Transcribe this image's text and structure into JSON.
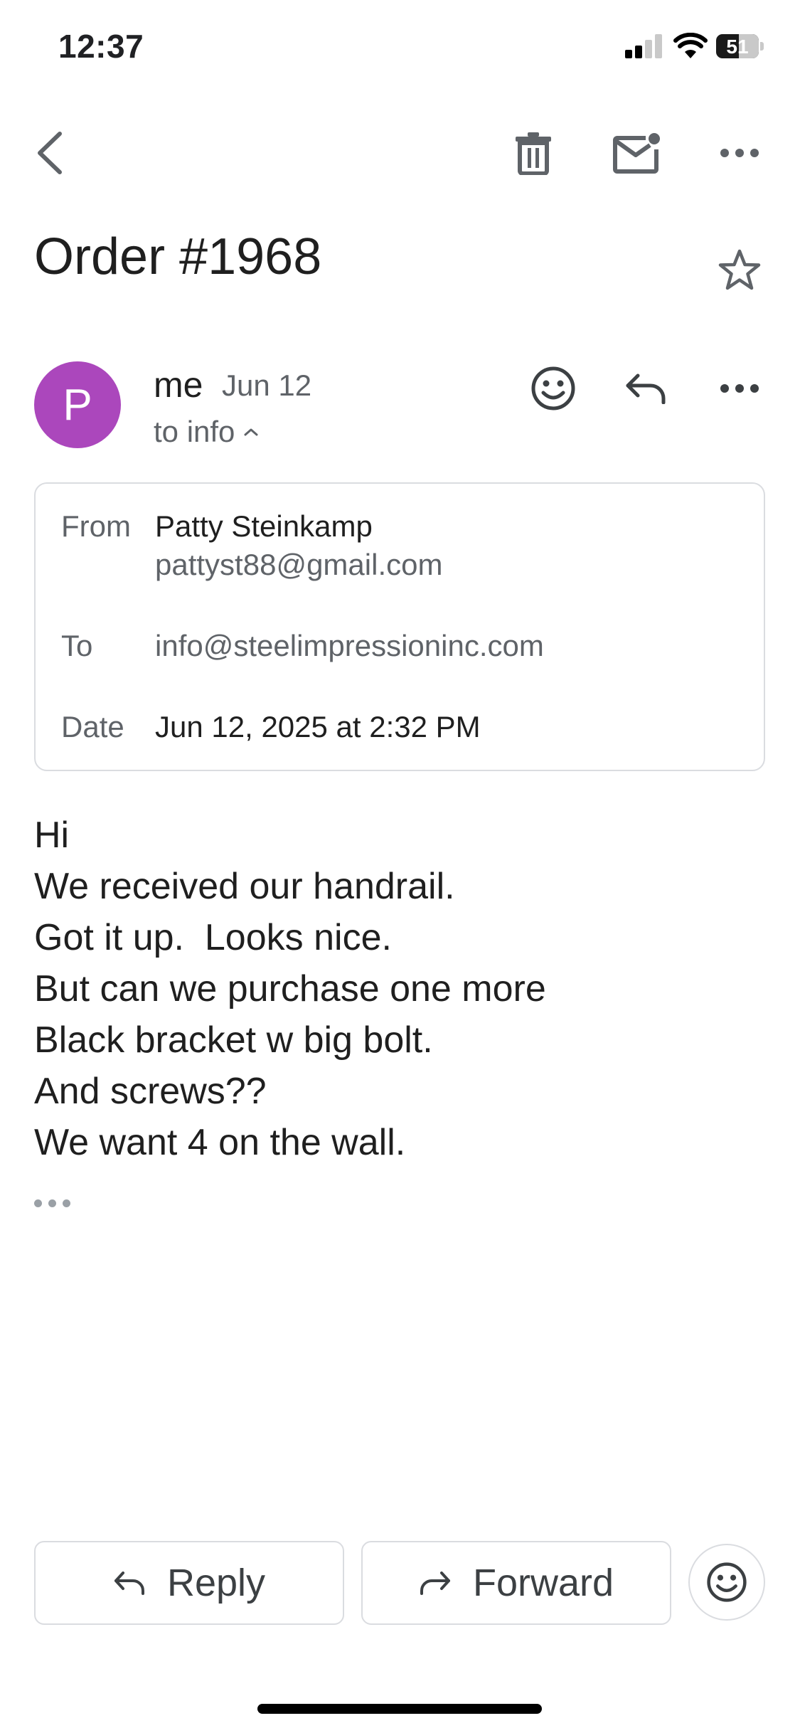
{
  "status_bar": {
    "time": "12:37",
    "battery": "51"
  },
  "toolbar": {
    "back_icon": "chevron-left-icon",
    "delete_icon": "trash-icon",
    "mark_unread_icon": "mail-unread-icon",
    "more_icon": "more-horizontal-icon"
  },
  "message": {
    "subject": "Order #1968",
    "avatar_letter": "P",
    "avatar_color": "#ab47bc",
    "sender": "me",
    "date_short": "Jun 12",
    "to_summary": "to info",
    "details": {
      "from_label": "From",
      "from_name": "Patty Steinkamp",
      "from_email": "pattyst88@gmail.com",
      "to_label": "To",
      "to_email": "info@steelimpressioninc.com",
      "date_label": "Date",
      "date_full": "Jun 12, 2025 at 2:32 PM"
    },
    "body_lines": [
      "Hi",
      "We received our handrail.",
      "Got it up.  Looks nice.",
      "But can we purchase one more",
      "Black bracket w big bolt.",
      "And screws??",
      "We want 4 on the wall."
    ]
  },
  "actions": {
    "reply_label": "Reply",
    "forward_label": "Forward"
  }
}
